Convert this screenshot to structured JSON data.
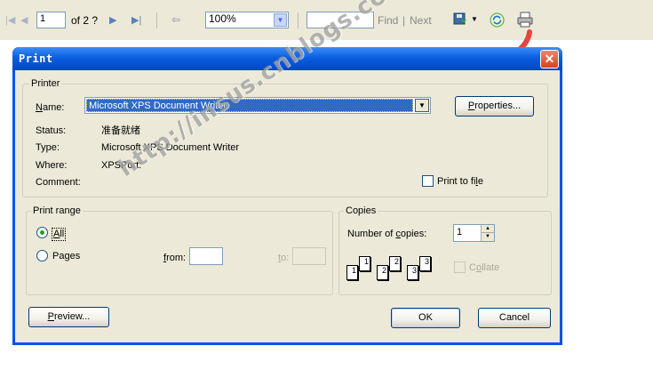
{
  "toolbar": {
    "page_number": "1",
    "page_count_text": "of 2 ?",
    "zoom_value": "100%",
    "search_value": "",
    "find_label": "Find",
    "separator": "|",
    "next_label": "Next"
  },
  "dialog": {
    "title": "Print",
    "close_glyph": "✕",
    "printer_group": {
      "label": "Printer",
      "name_label": "Name:",
      "name_value": "Microsoft XPS Document Writer",
      "properties_label": "Properties...",
      "status_label": "Status:",
      "status_value": "准备就绪",
      "type_label": "Type:",
      "type_value": "Microsoft XPS Document Writer",
      "where_label": "Where:",
      "where_value": "XPSPort:",
      "comment_label": "Comment:",
      "comment_value": "",
      "print_to_file_label": "Print to file",
      "print_to_file_checked": false
    },
    "print_range_group": {
      "label": "Print range",
      "all_label": "All",
      "all_selected": true,
      "pages_label": "Pages",
      "from_label": "from:",
      "from_value": "",
      "to_label": "to:",
      "to_value": ""
    },
    "copies_group": {
      "label": "Copies",
      "number_label": "Number of copies:",
      "number_value": "1",
      "collate_label": "Collate",
      "collate_checked": false,
      "page_icons": [
        "1",
        "1",
        "2",
        "2",
        "3",
        "3"
      ]
    },
    "preview_label": "Preview...",
    "ok_label": "OK",
    "cancel_label": "Cancel"
  },
  "watermark_text": "http://insus.cnblogs.com",
  "colors": {
    "dialog_face": "#ece9d8",
    "titlebar": "#0a5fe0",
    "annotation_arrow": "#e8453c"
  }
}
